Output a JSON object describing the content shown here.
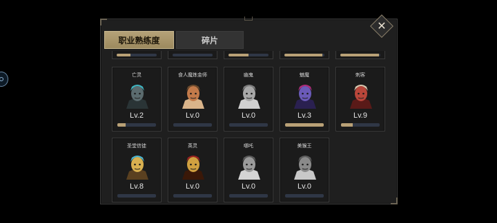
{
  "tabs": [
    {
      "label": "职业熟练度",
      "active": true
    },
    {
      "label": "碎片",
      "active": false
    }
  ],
  "close_icon": "close-icon",
  "edge_icon": "hint-icon",
  "partial_row": [
    {
      "progress": 0.35
    },
    {
      "progress": 0.0
    },
    {
      "progress": 0.5
    },
    {
      "progress": 0.95
    },
    {
      "progress": 0.97
    }
  ],
  "heroes": [
    {
      "name": "亡灵",
      "level": "Lv.2",
      "progress": 0.22,
      "portrait": "undead-portrait",
      "unlocked": true,
      "colors": [
        "#5b6b6e",
        "#3fb4c0",
        "#2a3436"
      ]
    },
    {
      "name": "食人魔炼金师",
      "level": "Lv.0",
      "progress": 0.0,
      "portrait": "ogre-alchemist-portrait",
      "unlocked": true,
      "colors": [
        "#c27a4a",
        "#6b4a2c",
        "#d9b48a"
      ]
    },
    {
      "name": "幽鬼",
      "level": "Lv.0",
      "progress": 0.0,
      "portrait": "specter-portrait",
      "unlocked": false,
      "colors": [
        "#a8a8a8",
        "#7c7c7c",
        "#d0d0d0"
      ]
    },
    {
      "name": "魅魔",
      "level": "Lv.3",
      "progress": 1.0,
      "portrait": "succubus-portrait",
      "unlocked": true,
      "colors": [
        "#6a5ab8",
        "#b02c7a",
        "#2a2050"
      ]
    },
    {
      "name": "刺客",
      "level": "Lv.9",
      "progress": 0.3,
      "portrait": "assassin-portrait",
      "unlocked": true,
      "colors": [
        "#b8463a",
        "#d8c8b0",
        "#5a1a18"
      ]
    },
    {
      "name": "圣堂信徒",
      "level": "Lv.8",
      "progress": 0.0,
      "portrait": "templar-portrait",
      "unlocked": true,
      "colors": [
        "#d8b050",
        "#4ab4d0",
        "#5a4020"
      ]
    },
    {
      "name": "英灵",
      "level": "Lv.0",
      "progress": 0.0,
      "portrait": "hero-spirit-portrait",
      "unlocked": true,
      "colors": [
        "#d0a040",
        "#9a2020",
        "#3a1808"
      ]
    },
    {
      "name": "哪吒",
      "level": "Lv.0",
      "progress": 0.0,
      "portrait": "nezha-portrait",
      "unlocked": false,
      "colors": [
        "#9a9a9a",
        "#5a5a5a",
        "#d4d4d4"
      ]
    },
    {
      "name": "美猴王",
      "level": "Lv.0",
      "progress": 0.0,
      "portrait": "monkey-king-portrait",
      "unlocked": false,
      "colors": [
        "#8a8a8a",
        "#5c5c5c",
        "#c8c8c8"
      ]
    }
  ]
}
